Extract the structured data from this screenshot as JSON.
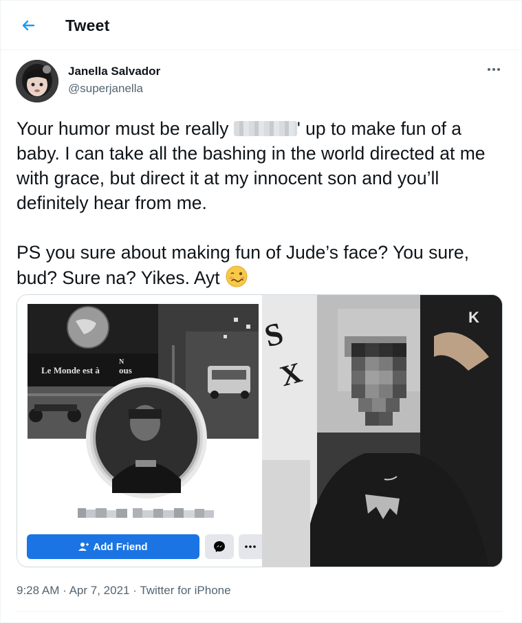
{
  "header": {
    "title": "Tweet",
    "back_icon": "arrow-left-icon",
    "accent": "#1d9bf0"
  },
  "author": {
    "name": "Janella Salvador",
    "handle": "@superjanella",
    "avatar": "avatar-photo"
  },
  "tweet": {
    "line1_pre": "Your humor must be really ",
    "line1_post": "' up to make fun of a baby. I can take all the bashing in the world directed at me with grace, but direct it at my innocent son and you’ll definitely hear from me.",
    "line2": "PS you sure about making fun of Jude’s face? You sure, bud? Sure na? Yikes. Ayt",
    "emoji": "woozy-face-emoji"
  },
  "media": {
    "left": {
      "banner_text_main": "Le Monde est à",
      "banner_text_n": "N",
      "banner_text_end": "ous",
      "add_friend_label": "Add Friend",
      "add_friend_color": "#1b74e4",
      "messenger_icon": "messenger-icon",
      "more_icon": "ellipsis-icon"
    },
    "right": {
      "description_icon": "photo"
    }
  },
  "meta": {
    "time": "9:28 AM",
    "sep1": "·",
    "date": "Apr 7, 2021",
    "sep2": "·",
    "source": "Twitter for iPhone"
  }
}
